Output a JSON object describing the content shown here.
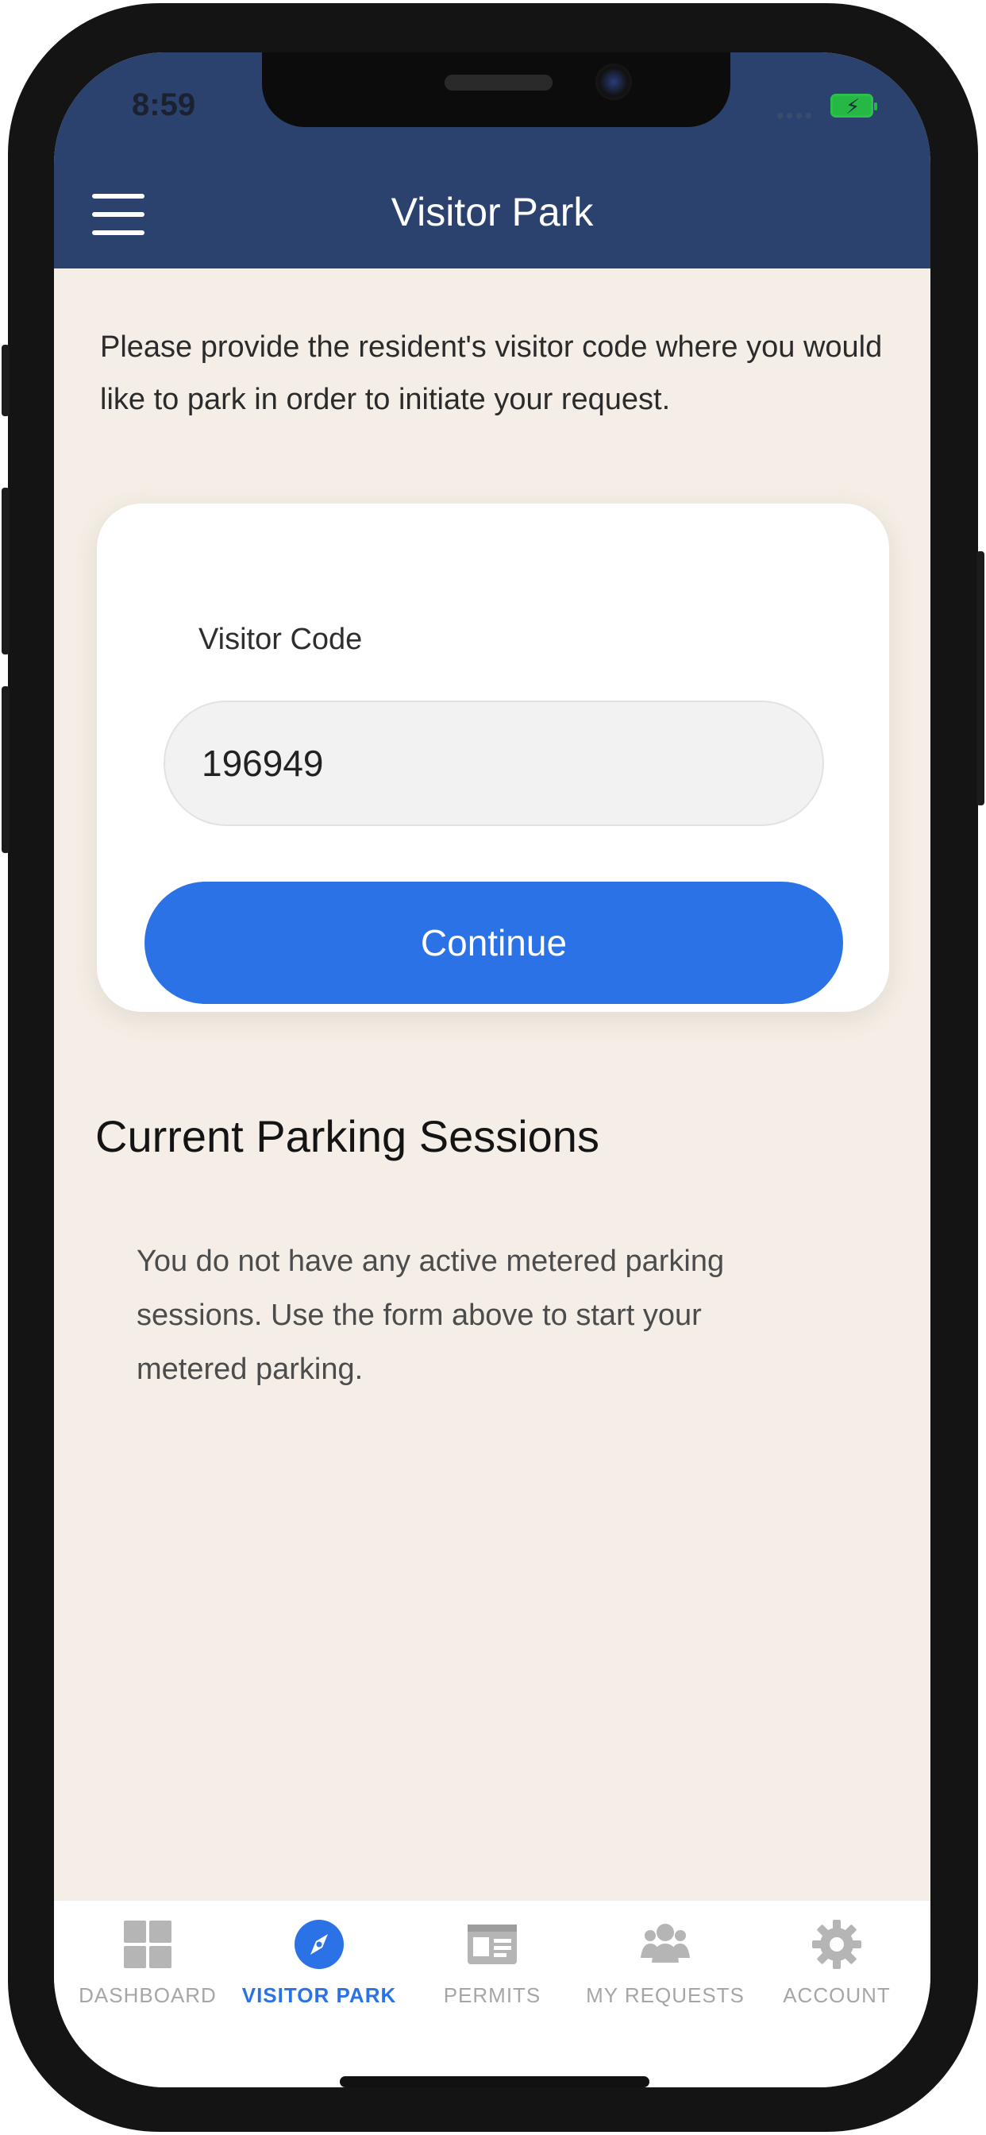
{
  "status_bar": {
    "time": "8:59"
  },
  "header": {
    "title": "Visitor Park"
  },
  "intro_text": "Please provide the resident's visitor code where you would like to park in order to initiate your request.",
  "form": {
    "label": "Visitor Code",
    "value": "196949",
    "button_label": "Continue"
  },
  "sessions": {
    "title": "Current Parking Sessions",
    "empty_text": "You do not have any active metered parking sessions. Use the form above to start your metered parking."
  },
  "tabs": [
    {
      "label": "DASHBOARD",
      "icon": "dashboard-grid-icon",
      "active": false
    },
    {
      "label": "VISITOR PARK",
      "icon": "compass-icon",
      "active": true
    },
    {
      "label": "PERMITS",
      "icon": "id-card-icon",
      "active": false
    },
    {
      "label": "MY REQUESTS",
      "icon": "users-icon",
      "active": false
    },
    {
      "label": "ACCOUNT",
      "icon": "gear-icon",
      "active": false
    }
  ],
  "colors": {
    "header": "#2a426d",
    "background": "#f4eee6",
    "accent": "#2b72e6",
    "inactive_tab": "#a6a6a6"
  }
}
